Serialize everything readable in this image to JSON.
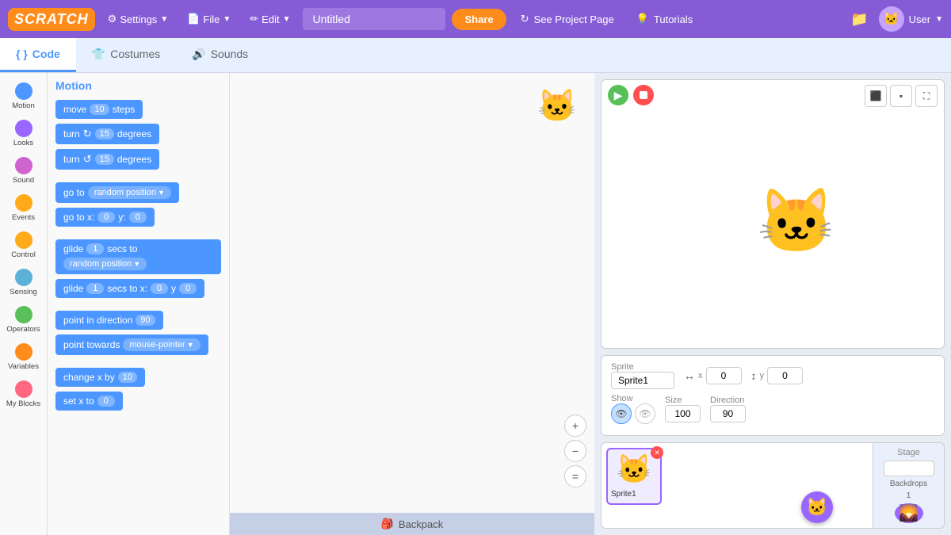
{
  "navbar": {
    "logo": "SCRATCH",
    "settings_label": "Settings",
    "file_label": "File",
    "edit_label": "Edit",
    "project_title": "Untitled",
    "share_label": "Share",
    "see_project_label": "See Project Page",
    "tutorials_label": "Tutorials",
    "user_label": "User"
  },
  "tabs": {
    "code_label": "Code",
    "costumes_label": "Costumes",
    "sounds_label": "Sounds"
  },
  "sidebar": {
    "categories": [
      {
        "id": "motion",
        "label": "Motion",
        "color": "#4c97ff"
      },
      {
        "id": "looks",
        "label": "Looks",
        "color": "#9966ff"
      },
      {
        "id": "sound",
        "label": "Sound",
        "color": "#cf63cf"
      },
      {
        "id": "events",
        "label": "Events",
        "color": "#ffab19"
      },
      {
        "id": "control",
        "label": "Control",
        "color": "#ffab19"
      },
      {
        "id": "sensing",
        "label": "Sensing",
        "color": "#5cb1d6"
      },
      {
        "id": "operators",
        "label": "Operators",
        "color": "#59c059"
      },
      {
        "id": "variables",
        "label": "Variables",
        "color": "#ff8c1a"
      },
      {
        "id": "my_blocks",
        "label": "My Blocks",
        "color": "#ff6680"
      }
    ]
  },
  "blocks_panel": {
    "title": "Motion",
    "blocks": [
      {
        "id": "move",
        "text": "move",
        "value": "10",
        "suffix": "steps"
      },
      {
        "id": "turn_cw",
        "text": "turn ↻",
        "value": "15",
        "suffix": "degrees"
      },
      {
        "id": "turn_ccw",
        "text": "turn ↺",
        "value": "15",
        "suffix": "degrees"
      },
      {
        "id": "goto",
        "text": "go to",
        "dropdown": "random position"
      },
      {
        "id": "goto_xy",
        "text": "go to x:",
        "x_val": "0",
        "y_val": "0"
      },
      {
        "id": "glide_to",
        "text": "glide",
        "value": "1",
        "mid": "secs to",
        "dropdown": "random position"
      },
      {
        "id": "glide_xy",
        "text": "glide",
        "value": "1",
        "mid": "secs to x:",
        "x_val": "0",
        "y_suffix": "y",
        "y_val": "0"
      },
      {
        "id": "point_dir",
        "text": "point in direction",
        "value": "90"
      },
      {
        "id": "point_towards",
        "text": "point towards",
        "dropdown": "mouse-pointer"
      },
      {
        "id": "change_x",
        "text": "change x by",
        "value": "10"
      },
      {
        "id": "set_x",
        "text": "set x to",
        "value": "0"
      }
    ]
  },
  "stage": {
    "green_flag_label": "▶",
    "stop_label": "",
    "sprite_name": "Sprite1",
    "x_coord": "0",
    "y_coord": "0",
    "size": "100",
    "direction": "90"
  },
  "sprites": [
    {
      "id": "sprite1",
      "label": "Sprite1",
      "emoji": "🐱"
    }
  ],
  "stage_section": {
    "title": "Stage",
    "backdrops_label": "Backdrops",
    "backdrops_count": "1"
  },
  "backpack": {
    "label": "Backpack"
  },
  "zoom_controls": {
    "zoom_in": "+",
    "zoom_out": "−",
    "fit": "="
  }
}
